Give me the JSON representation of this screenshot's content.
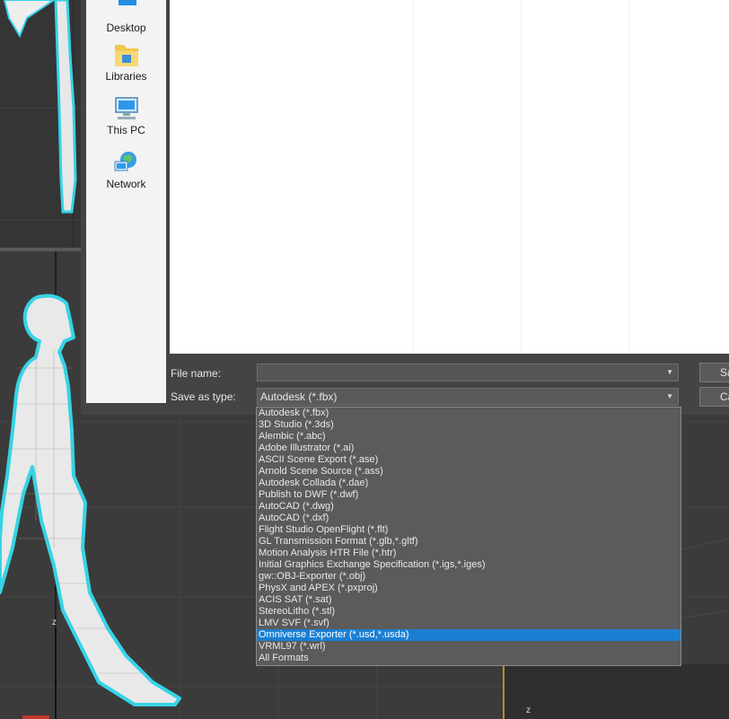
{
  "places": [
    {
      "label": "Desktop",
      "icon": "desktop-icon"
    },
    {
      "label": "Libraries",
      "icon": "libraries-icon"
    },
    {
      "label": "This PC",
      "icon": "this-pc-icon"
    },
    {
      "label": "Network",
      "icon": "network-icon"
    }
  ],
  "form": {
    "file_name_label": "File name:",
    "file_name_value": "",
    "save_as_type_label": "Save as type:",
    "save_as_type_value": "Autodesk (*.fbx)"
  },
  "buttons": {
    "save_label": "Sa",
    "cancel_label": "Ca"
  },
  "file_types": [
    "Autodesk (*.fbx)",
    "3D Studio (*.3ds)",
    "Alembic (*.abc)",
    "Adobe Illustrator (*.ai)",
    "ASCII Scene Export (*.ase)",
    "Arnold Scene Source (*.ass)",
    "Autodesk Collada (*.dae)",
    "Publish to DWF (*.dwf)",
    "AutoCAD (*.dwg)",
    "AutoCAD (*.dxf)",
    "Flight Studio OpenFlight (*.flt)",
    "GL Transmission Format (*.glb,*.gltf)",
    "Motion Analysis HTR File (*.htr)",
    "Initial Graphics Exchange Specification (*.igs,*.iges)",
    "gw::OBJ-Exporter (*.obj)",
    "PhysX and APEX (*.pxproj)",
    "ACIS SAT (*.sat)",
    "StereoLitho (*.stl)",
    "LMV SVF (*.svf)",
    "Omniverse Exporter (*.usd,*.usda)",
    "VRML97 (*.wrl)",
    "All Formats"
  ],
  "selected_file_type_index": 19,
  "viewport": {
    "axis_z_label": "z",
    "axis_z_label_2": "z"
  },
  "colors": {
    "selection": "#1a7fd3",
    "wire_outline": "#36d3e6"
  }
}
